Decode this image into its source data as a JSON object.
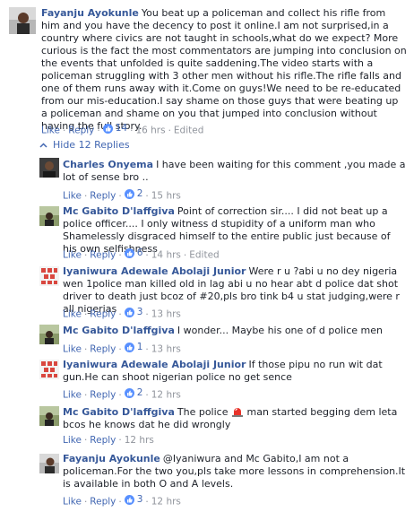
{
  "comments": [
    {
      "author": "Fayanju Ayokunle",
      "text": "You beat up a policeman and collect his rifle from him and you have the decency to post it online.I am not surprised,in a country where civics are not taught in schools,what do we expect? More curious is the fact the most commentators are jumping into conclusion on the events that unfolded is quite saddening.The video starts with a policeman struggling with 3 other men without his rifle.The rifle falls and one of them runs away with it.Come on guys!We need to be re-educated from our mis-education.I say shame on those guys that were beating up a policeman and shame on you that jumped into conclusion without having the full story.",
      "like": "Like",
      "reply": "Reply",
      "likes": "14",
      "time": "16 hrs",
      "edited": "Edited"
    }
  ],
  "hide_replies": "Hide 12 Replies",
  "replies": [
    {
      "author": "Charles Onyema",
      "text": "I have been waiting for this comment ,you made a lot of sense bro ..",
      "like": "Like",
      "reply": "Reply",
      "likes": "2",
      "time": "15 hrs"
    },
    {
      "author": "Mc Gabito D'laffgiva",
      "text": "Point of correction sir.... I did not beat up a police officer.... I only witness d stupidity of a uniform man who Shamelessly disgraced himself to the entire public just because of his own selfishness",
      "like": "Like",
      "reply": "Reply",
      "likes": "6",
      "time": "14 hrs",
      "edited": "Edited"
    },
    {
      "author": "Iyaniwura Adewale Abolaji Junior",
      "text": "Were r u ?abi u no dey nigeria wen 1police man killed old in lag abi u no hear abt d police dat shot driver to death just bcoz of #20,pls bro tink b4 u stat judging,were r all nigerias",
      "like": "Like",
      "reply": "Reply",
      "likes": "3",
      "time": "13 hrs"
    },
    {
      "author": "Mc Gabito D'laffgiva",
      "text": "I wonder... Maybe his one of d police men",
      "like": "Like",
      "reply": "Reply",
      "likes": "1",
      "time": "13 hrs"
    },
    {
      "author": "Iyaniwura Adewale Abolaji Junior",
      "text": "If those pipu no run wit dat gun.He can shoot nigerian police no get sence",
      "like": "Like",
      "reply": "Reply",
      "likes": "2",
      "time": "12 hrs"
    },
    {
      "author": "Mc Gabito D'laffgiva",
      "text_before": "The police",
      "text_after": "man started begging dem leta bcos he knows dat he did wrongly",
      "like": "Like",
      "reply": "Reply",
      "time": "12 hrs"
    },
    {
      "author": "Fayanju Ayokunle",
      "text": "@Iyaniwura and Mc Gabito,I am not a policeman.For the two you,pls take more lessons in comprehension.It is available in both O and A levels.",
      "like": "Like",
      "reply": "Reply",
      "likes": "3",
      "time": "12 hrs"
    }
  ],
  "colors": {
    "link": "#4267b2",
    "author": "#365899",
    "meta": "#90949c",
    "like_badge": "#5890ff"
  }
}
